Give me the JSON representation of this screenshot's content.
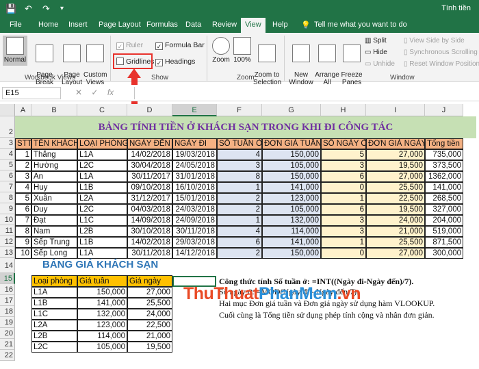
{
  "window": {
    "title": "Tính tiền"
  },
  "tabs": [
    {
      "label": "File"
    },
    {
      "label": "Home"
    },
    {
      "label": "Insert"
    },
    {
      "label": "Page Layout"
    },
    {
      "label": "Formulas"
    },
    {
      "label": "Data"
    },
    {
      "label": "Review"
    },
    {
      "label": "View"
    },
    {
      "label": "Help"
    }
  ],
  "tell_me": "Tell me what you want to do",
  "ribbon": {
    "normal": "Normal",
    "page_break": "Page Break\nPreview",
    "page_layout": "Page\nLayout",
    "custom_views": "Custom\nViews",
    "group_workbook_views": "Workbook Views",
    "ruler": "Ruler",
    "gridlines": "Gridlines",
    "formula_bar": "Formula Bar",
    "headings": "Headings",
    "group_show": "Show",
    "zoom": "Zoom",
    "zoom100": "100%",
    "zoom_selection": "Zoom to\nSelection",
    "group_zoom": "Zoom",
    "new_window": "New\nWindow",
    "arrange_all": "Arrange\nAll",
    "freeze_panes": "Freeze\nPanes ▾",
    "split": "Split",
    "hide": "Hide",
    "unhide": "Unhide",
    "side_by_side": "View Side by Side",
    "sync_scroll": "Synchronous Scrolling",
    "reset_pos": "Reset Window Position",
    "group_window": "Window"
  },
  "formula_bar": {
    "cell_ref": "E15",
    "fx": "fx",
    "value": ""
  },
  "columns": [
    "A",
    "B",
    "C",
    "D",
    "E",
    "F",
    "G",
    "H",
    "I",
    "J"
  ],
  "rows": [
    "1",
    "2",
    "3",
    "4",
    "5",
    "6",
    "7",
    "8",
    "9",
    "10",
    "11",
    "12",
    "13",
    "14",
    "15",
    "16",
    "17",
    "18",
    "19",
    "20",
    "21",
    "22"
  ],
  "banner": "BẢNG TÍNH TIỀN Ở KHÁCH SẠN TRONG KHI ĐI CÔNG TÁC",
  "table_headers": [
    "STT",
    "TÊN KHÁCH",
    "LOẠI PHÒNG",
    "NGÀY ĐẾN",
    "NGÀY ĐI",
    "SỐ TUẦN Ở",
    "ĐƠN GIÁ TUẦN",
    "SỐ NGÀY Ở",
    "ĐƠN GIÁ NGÀY",
    "Tổng tiền"
  ],
  "table_rows": [
    [
      "1",
      "Thắng",
      "L1A",
      "14/02/2018",
      "19/03/2018",
      "4",
      "150,000",
      "5",
      "27,000",
      "735,000"
    ],
    [
      "2",
      "Hường",
      "L2C",
      "30/04/2018",
      "24/05/2018",
      "3",
      "105,000",
      "3",
      "19,500",
      "373,500"
    ],
    [
      "3",
      "An",
      "L1A",
      "30/11/2017",
      "31/01/2018",
      "8",
      "150,000",
      "6",
      "27,000",
      "1362,000"
    ],
    [
      "4",
      "Huy",
      "L1B",
      "09/10/2018",
      "16/10/2018",
      "1",
      "141,000",
      "0",
      "25,500",
      "141,000"
    ],
    [
      "5",
      "Xuân",
      "L2A",
      "31/12/2017",
      "15/01/2018",
      "2",
      "123,000",
      "1",
      "22,500",
      "268,500"
    ],
    [
      "6",
      "Duy",
      "L2C",
      "04/03/2018",
      "24/03/2018",
      "2",
      "105,000",
      "6",
      "19,500",
      "327,000"
    ],
    [
      "7",
      "Đạt",
      "L1C",
      "14/09/2018",
      "24/09/2018",
      "1",
      "132,000",
      "3",
      "24,000",
      "204,000"
    ],
    [
      "8",
      "Nam",
      "L2B",
      "30/10/2018",
      "30/11/2018",
      "4",
      "114,000",
      "3",
      "21,000",
      "519,000"
    ],
    [
      "9",
      "Sếp Trung",
      "L1B",
      "14/02/2018",
      "29/03/2018",
      "6",
      "141,000",
      "1",
      "25,500",
      "871,500"
    ],
    [
      "10",
      "Sếp Long",
      "L1A",
      "30/11/2018",
      "14/12/2018",
      "2",
      "150,000",
      "0",
      "27,000",
      "300,000"
    ]
  ],
  "price_title": "BẢNG GIÁ KHÁCH SẠN",
  "price_headers": [
    "Loại phòng",
    "Giá tuần",
    "Giá ngày"
  ],
  "price_rows": [
    [
      "L1A",
      "150,000",
      "27,000"
    ],
    [
      "L1B",
      "141,000",
      "25,500"
    ],
    [
      "L1C",
      "132,000",
      "24,000"
    ],
    [
      "L2A",
      "123,000",
      "22,500"
    ],
    [
      "L2B",
      "114,000",
      "21,000"
    ],
    [
      "L2C",
      "105,000",
      "19,500"
    ]
  ],
  "notes": [
    "Công thức tính Số tuần ở: =INT((Ngày đi-Ngày đến)/7).",
    "Số ngày ở: =MOD(Ngày đi - Ngày đến,7).",
    "Hai mục Đơn giá tuần và Đơn giá ngày sử dụng hàm VLOOKUP.",
    "Cuối cùng là Tổng tiền sử dụng phép tính cộng và nhân đơn giản."
  ],
  "watermark": {
    "part1": "ThuThuat",
    "part2": "PhanMem",
    "part3": ".vn"
  },
  "colors": {
    "excel_green": "#217346",
    "header_orange": "#f4b183",
    "banner_green": "#c6e0b4",
    "price_header": "#ffc000",
    "highlight_red": "#e8322c"
  }
}
